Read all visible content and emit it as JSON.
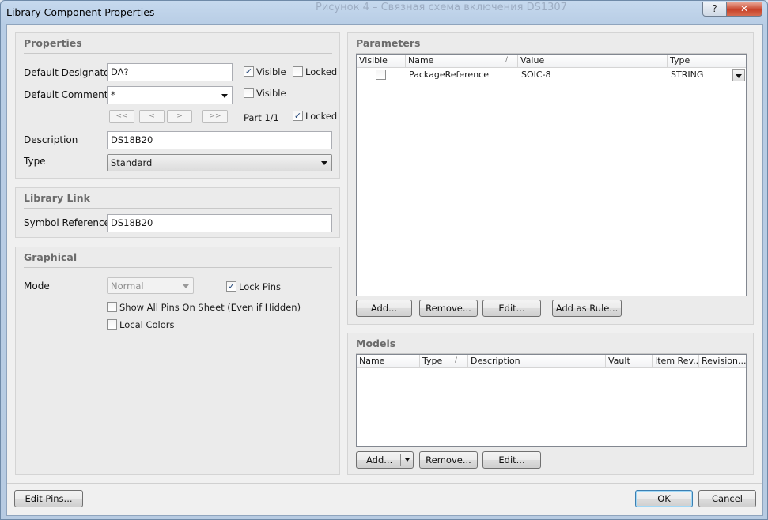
{
  "window": {
    "title": "Library Component Properties",
    "ghost_text": "Рисунок 4 – Связная схема включения DS1307",
    "help_label": "?",
    "close_label": "✕"
  },
  "properties": {
    "title": "Properties",
    "designator_label": "Default Designator",
    "designator_value": "DA?",
    "visible_label": "Visible",
    "locked_label": "Locked",
    "comment_label": "Default Comment",
    "comment_value": "*",
    "comment_visible_label": "Visible",
    "nav": [
      "<<",
      "<",
      ">",
      ">>"
    ],
    "part_label": "Part 1/1",
    "part_locked_label": "Locked",
    "description_label": "Description",
    "description_value": "DS18B20",
    "type_label": "Type",
    "type_value": "Standard",
    "checks": {
      "designator_visible": true,
      "designator_locked": false,
      "comment_visible": false,
      "part_locked": true
    }
  },
  "library_link": {
    "title": "Library Link",
    "symbol_label": "Symbol Reference",
    "symbol_value": "DS18B20"
  },
  "graphical": {
    "title": "Graphical",
    "mode_label": "Mode",
    "mode_value": "Normal",
    "lock_pins_label": "Lock Pins",
    "show_pins_label": "Show All Pins On Sheet (Even if Hidden)",
    "local_colors_label": "Local Colors",
    "checks": {
      "lock_pins": true,
      "show_pins": false,
      "local_colors": false
    }
  },
  "parameters": {
    "title": "Parameters",
    "columns": [
      "Visible",
      "Name",
      "Value",
      "Type"
    ],
    "sort_indicator": "/",
    "rows": [
      {
        "visible": false,
        "name": "PackageReference",
        "value": "SOIC-8",
        "type": "STRING"
      }
    ],
    "buttons": [
      "Add...",
      "Remove...",
      "Edit...",
      "Add as Rule..."
    ]
  },
  "models": {
    "title": "Models",
    "columns": [
      "Name",
      "Type",
      "Description",
      "Vault",
      "Item Rev...",
      "Revision..."
    ],
    "sort_indicator": "/",
    "buttons": [
      "Add...",
      "Remove...",
      "Edit..."
    ]
  },
  "footer": {
    "edit_pins": "Edit Pins...",
    "ok": "OK",
    "cancel": "Cancel"
  }
}
